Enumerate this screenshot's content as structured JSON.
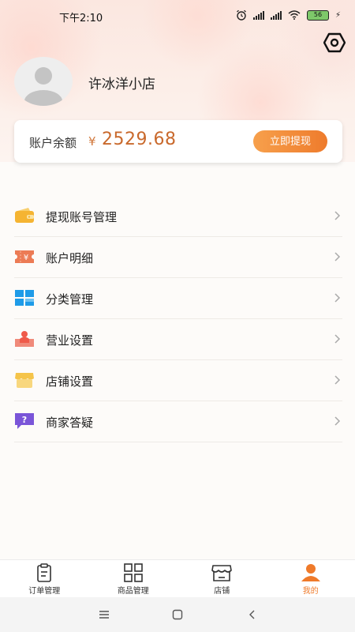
{
  "status_bar": {
    "time": "下午2:10",
    "battery": "56",
    "icons": [
      "alarm-icon",
      "signal-icon",
      "signal-icon",
      "wifi-icon",
      "battery-icon",
      "charging-icon"
    ]
  },
  "header": {
    "shop_name": "许冰洋小店",
    "settings_icon": "hexagon-settings-icon"
  },
  "balance": {
    "label": "账户余额",
    "currency": "¥",
    "amount": "2529.68",
    "withdraw_label": "立即提现"
  },
  "menu": {
    "items": [
      {
        "label": "提现账号管理",
        "icon": "wallet-icon",
        "color": "#f5b432"
      },
      {
        "label": "账户明细",
        "icon": "ticket-yuan-icon",
        "color": "#ec7b55"
      },
      {
        "label": "分类管理",
        "icon": "category-grid-icon",
        "color": "#1e9be8"
      },
      {
        "label": "营业设置",
        "icon": "business-person-icon",
        "color": "#ef5a4a"
      },
      {
        "label": "店铺设置",
        "icon": "shop-store-icon",
        "color": "#f5c44a"
      },
      {
        "label": "商家答疑",
        "icon": "question-chat-icon",
        "color": "#7a55d8"
      }
    ]
  },
  "tabbar": {
    "tabs": [
      {
        "label": "订单管理",
        "icon": "clipboard-icon",
        "active": false
      },
      {
        "label": "商品管理",
        "icon": "grid-icon",
        "active": false
      },
      {
        "label": "店铺",
        "icon": "store-icon",
        "active": false
      },
      {
        "label": "我的",
        "icon": "user-icon",
        "active": true
      }
    ],
    "active_color": "#ef7a2a"
  },
  "system_nav": [
    "menu-icon",
    "home-icon",
    "back-icon"
  ]
}
